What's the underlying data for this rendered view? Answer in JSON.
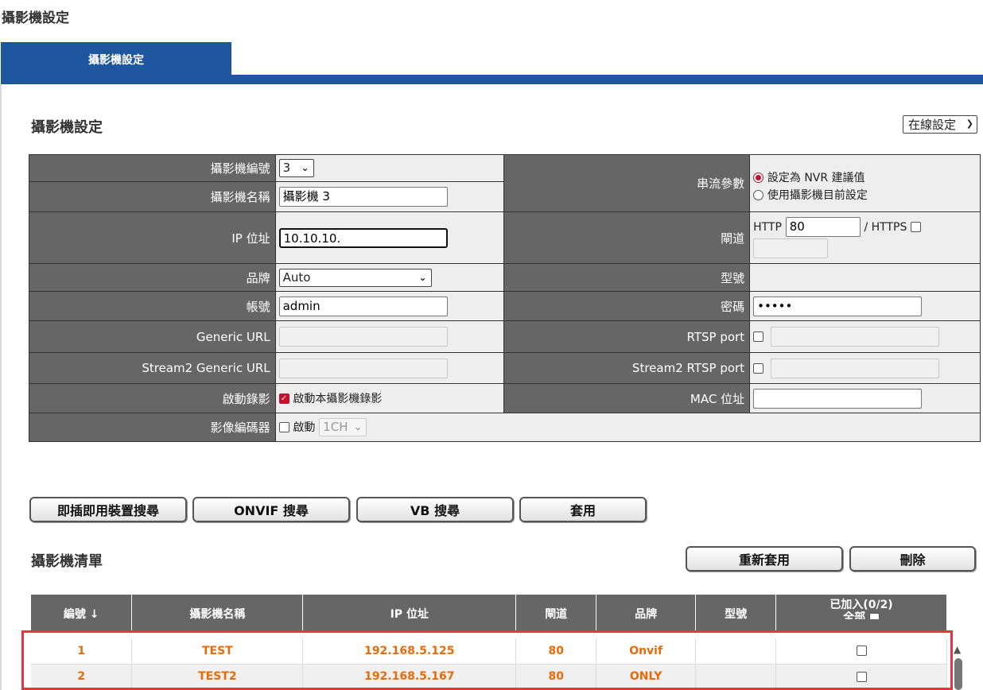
{
  "page_title": "攝影機設定",
  "tabs": [
    {
      "label": "攝影機設定"
    }
  ],
  "section": {
    "title": "攝影機設定",
    "mode_select": "在線設定"
  },
  "form": {
    "camera_no_label": "攝影機編號",
    "camera_no_value": "3",
    "camera_name_label": "攝影機名稱",
    "camera_name_value": "攝影機 3",
    "ip_label": "IP 位址",
    "ip_value": "10.10.10.",
    "brand_label": "品牌",
    "brand_value": "Auto",
    "account_label": "帳號",
    "account_value": "admin",
    "generic_url_label": "Generic URL",
    "stream2_url_label": "Stream2 Generic URL",
    "record_label": "啟動錄影",
    "record_option": "啟動本攝影機錄影",
    "encoder_label": "影像編碼器",
    "encoder_option": "啟動",
    "encoder_select": "1CH",
    "stream_param_label": "串流參數",
    "stream_opt1": "設定為 NVR 建議值",
    "stream_opt2": "使用攝影機目前設定",
    "port_label": "閘道",
    "http_label": "HTTP",
    "http_value": "80",
    "https_label": "/ HTTPS",
    "model_label": "型號",
    "password_label": "密碼",
    "password_value": "•••••",
    "rtsp_label": "RTSP port",
    "stream2_rtsp_label": "Stream2 RTSP port",
    "mac_label": "MAC 位址"
  },
  "buttons": {
    "pnp_search": "即插即用裝置搜尋",
    "onvif_search": "ONVIF 搜尋",
    "vb_search": "VB 搜尋",
    "apply": "套用",
    "reapply": "重新套用",
    "delete": "刪除"
  },
  "list": {
    "title": "攝影機清單",
    "headers": {
      "no": "編號 ↓",
      "name": "攝影機名稱",
      "ip": "IP 位址",
      "port": "閘道",
      "brand": "品牌",
      "model": "型號",
      "added": "已加入(0/2)",
      "all": "全部"
    },
    "rows": [
      {
        "no": "1",
        "name": "TEST",
        "ip": "192.168.5.125",
        "port": "80",
        "brand": "Onvif",
        "model": ""
      },
      {
        "no": "2",
        "name": "TEST2",
        "ip": "192.168.5.167",
        "port": "80",
        "brand": "ONLY",
        "model": ""
      }
    ]
  },
  "colors": {
    "accent": "#1e56a0",
    "header_gray": "#666666",
    "row_text": "#e86b0a",
    "highlight": "#e8343a"
  }
}
